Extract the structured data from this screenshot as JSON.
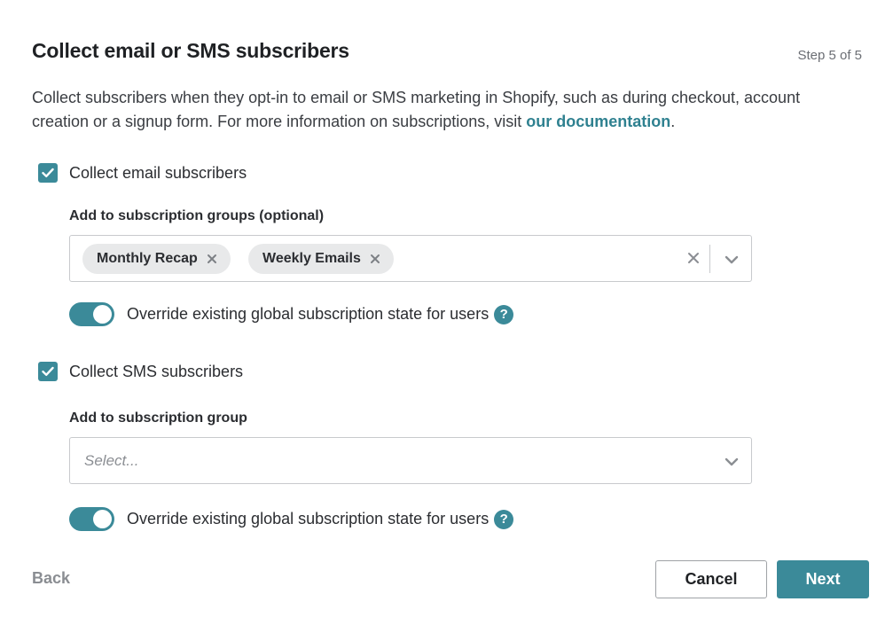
{
  "header": {
    "title": "Collect email or SMS subscribers",
    "step": "Step 5 of 5"
  },
  "description": {
    "text": "Collect subscribers when they opt-in to email or SMS marketing in Shopify, such as during checkout, account creation or a signup form. For more information on subscriptions, visit ",
    "link": "our documentation",
    "suffix": "."
  },
  "email": {
    "checkbox_label": "Collect email subscribers",
    "checked": true,
    "groups_label": "Add to subscription groups (optional)",
    "selected_groups": [
      "Monthly Recap",
      "Weekly Emails"
    ],
    "override_label": "Override existing global subscription state for users",
    "override_on": true
  },
  "sms": {
    "checkbox_label": "Collect SMS subscribers",
    "checked": true,
    "group_label": "Add to subscription group",
    "placeholder": "Select...",
    "override_label": "Override existing global subscription state for users",
    "override_on": true
  },
  "footer": {
    "back_label": "Back",
    "cancel_label": "Cancel",
    "next_label": "Next"
  },
  "colors": {
    "accent": "#3b8a99",
    "link": "#2f8190"
  },
  "icons": {
    "help": "?"
  }
}
